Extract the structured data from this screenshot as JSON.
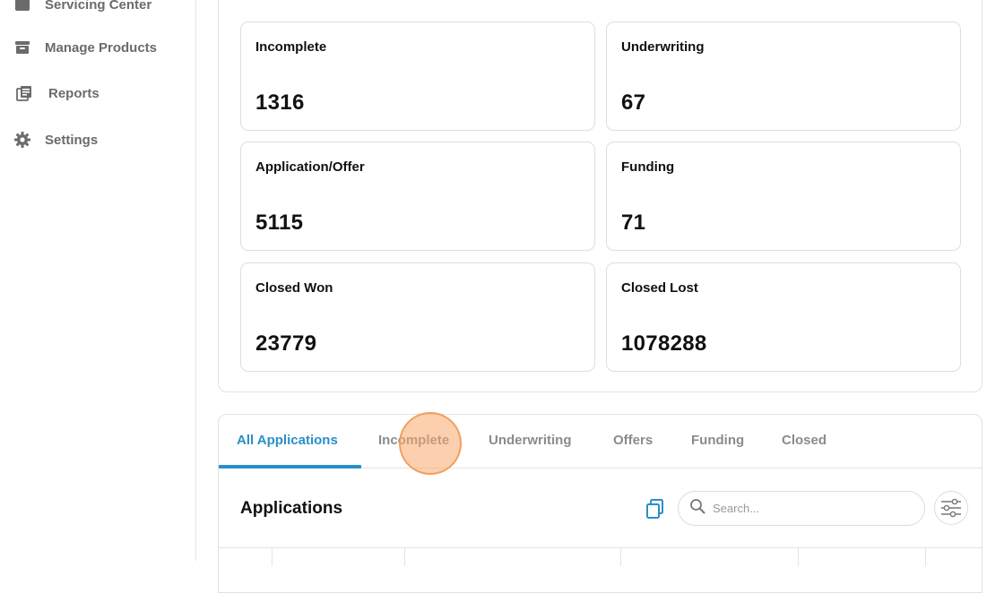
{
  "sidebar": {
    "items": [
      {
        "label": "Servicing Center",
        "icon": "folder-icon"
      },
      {
        "label": "Manage Products",
        "icon": "archive-icon"
      },
      {
        "label": "Reports",
        "icon": "reports-icon"
      },
      {
        "label": "Settings",
        "icon": "gear-icon"
      }
    ]
  },
  "stats": [
    {
      "label": "Incomplete",
      "value": "1316"
    },
    {
      "label": "Underwriting",
      "value": "67"
    },
    {
      "label": "Application/Offer",
      "value": "5115"
    },
    {
      "label": "Funding",
      "value": "71"
    },
    {
      "label": "Closed Won",
      "value": "23779"
    },
    {
      "label": "Closed Lost",
      "value": "1078288"
    }
  ],
  "tabs": [
    {
      "label": "All Applications",
      "active": true
    },
    {
      "label": "Incomplete",
      "active": false
    },
    {
      "label": "Underwriting",
      "active": false
    },
    {
      "label": "Offers",
      "active": false
    },
    {
      "label": "Funding",
      "active": false
    },
    {
      "label": "Closed",
      "active": false
    }
  ],
  "applications": {
    "title": "Applications",
    "search_placeholder": "Search..."
  },
  "colors": {
    "accent": "#2a8fc7",
    "muted_text": "#8b8b8b",
    "click_marker": "#f6a96a"
  }
}
